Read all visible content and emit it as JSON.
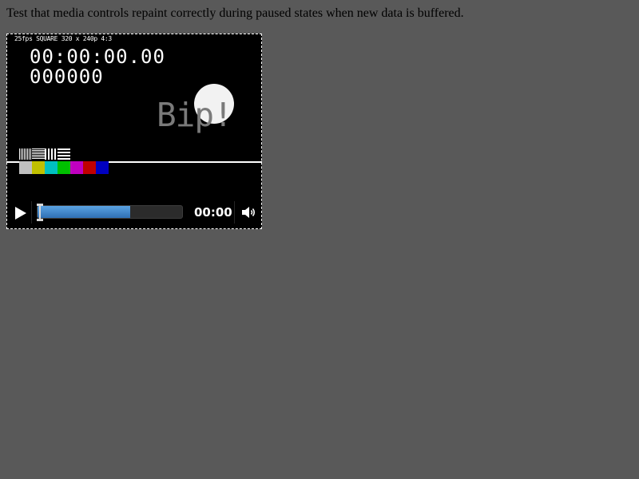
{
  "page": {
    "caption": "Test that media controls repaint correctly during paused states when new data is buffered."
  },
  "video": {
    "format_label": "25fps SQUARE 320 x 240p 4:3",
    "timecode": "00:00:00.00",
    "frame_counter": "000000",
    "overlay_text": "Bip!",
    "color_bars": [
      "#c0c0c0",
      "#c0c000",
      "#00c0c0",
      "#00c000",
      "#c000c0",
      "#c00000",
      "#0000c0"
    ]
  },
  "controls": {
    "play_icon": "play-icon",
    "mute_icon": "volume-icon",
    "current_time": "00:00",
    "buffered_fraction": 0.64,
    "playhead_fraction": 0.0,
    "accent_color": "#3d85c6"
  }
}
